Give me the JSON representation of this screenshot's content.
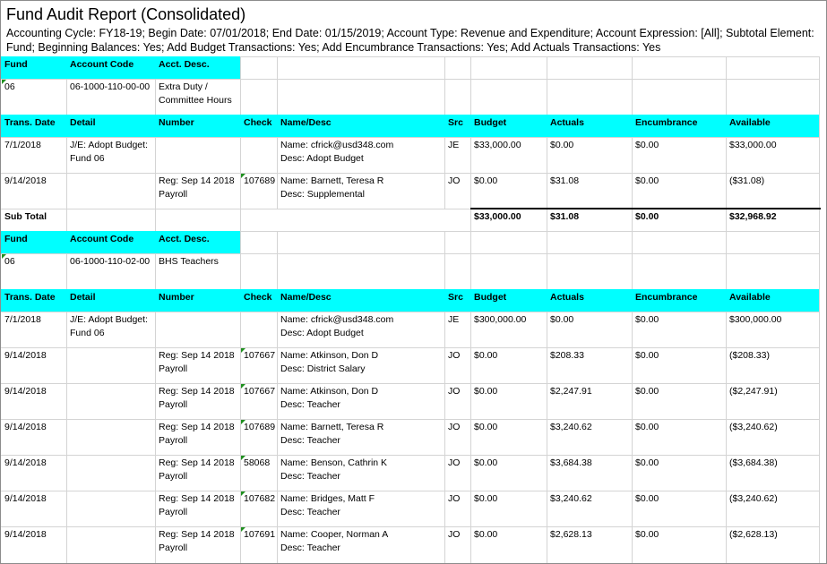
{
  "report": {
    "title": "Fund Audit Report (Consolidated)",
    "params": "Accounting Cycle: FY18-19; Begin Date: 07/01/2018; End Date: 01/15/2019; Account Type: Revenue and Expenditure; Account Expression: [All]; Subtotal Element: Fund; Beginning Balances: Yes; Add Budget Transactions: Yes; Add Encumbrance Transactions: Yes; Add Actuals Transactions: Yes"
  },
  "colors": {
    "header_band": "#00ffff",
    "grid": "#d4d4d4",
    "marker": "#1e8f1e"
  },
  "fund_headers": {
    "fund": "Fund",
    "account_code": "Account Code",
    "acct_desc": "Acct. Desc."
  },
  "trans_headers": {
    "date": "Trans. Date",
    "detail": "Detail",
    "number": "Number",
    "check": "Check",
    "name_desc": "Name/Desc",
    "src": "Src",
    "budget": "Budget",
    "actuals": "Actuals",
    "encumbrance": "Encumbrance",
    "available": "Available"
  },
  "sections": [
    {
      "fund": "06",
      "account_code": "06-1000-110-00-00",
      "acct_desc_1": "Extra Duty /",
      "acct_desc_2": "Committee Hours",
      "rows": [
        {
          "date": "7/1/2018",
          "detail_1": "J/E: Adopt Budget:",
          "detail_2": "Fund 06",
          "number_1": "",
          "number_2": "",
          "check": "",
          "name": "Name: cfrick@usd348.com",
          "desc": "Desc: Adopt Budget",
          "src": "JE",
          "budget": "$33,000.00",
          "actuals": "$0.00",
          "encumbrance": "$0.00",
          "available": "$33,000.00"
        },
        {
          "date": "9/14/2018",
          "detail_1": "",
          "detail_2": "",
          "number_1": "Reg: Sep 14 2018",
          "number_2": "Payroll",
          "check": "107689",
          "name": "Name: Barnett, Teresa R",
          "desc": "Desc: Supplemental",
          "src": "JO",
          "budget": "$0.00",
          "actuals": "$31.08",
          "encumbrance": "$0.00",
          "available": "($31.08)"
        }
      ],
      "subtotal": {
        "label": "Sub Total",
        "budget": "$33,000.00",
        "actuals": "$31.08",
        "encumbrance": "$0.00",
        "available": "$32,968.92"
      }
    },
    {
      "fund": "06",
      "account_code": "06-1000-110-02-00",
      "acct_desc_1": "BHS Teachers",
      "acct_desc_2": "",
      "rows": [
        {
          "date": "7/1/2018",
          "detail_1": "J/E: Adopt Budget:",
          "detail_2": "Fund 06",
          "number_1": "",
          "number_2": "",
          "check": "",
          "name": "Name: cfrick@usd348.com",
          "desc": "Desc: Adopt Budget",
          "src": "JE",
          "budget": "$300,000.00",
          "actuals": "$0.00",
          "encumbrance": "$0.00",
          "available": "$300,000.00"
        },
        {
          "date": "9/14/2018",
          "detail_1": "",
          "detail_2": "",
          "number_1": "Reg: Sep 14 2018",
          "number_2": "Payroll",
          "check": "107667",
          "name": "Name: Atkinson, Don D",
          "desc": "Desc: District Salary",
          "src": "JO",
          "budget": "$0.00",
          "actuals": "$208.33",
          "encumbrance": "$0.00",
          "available": "($208.33)"
        },
        {
          "date": "9/14/2018",
          "detail_1": "",
          "detail_2": "",
          "number_1": "Reg: Sep 14 2018",
          "number_2": "Payroll",
          "check": "107667",
          "name": "Name: Atkinson, Don D",
          "desc": "Desc: Teacher",
          "src": "JO",
          "budget": "$0.00",
          "actuals": "$2,247.91",
          "encumbrance": "$0.00",
          "available": "($2,247.91)"
        },
        {
          "date": "9/14/2018",
          "detail_1": "",
          "detail_2": "",
          "number_1": "Reg: Sep 14 2018",
          "number_2": "Payroll",
          "check": "107689",
          "name": "Name: Barnett, Teresa R",
          "desc": "Desc: Teacher",
          "src": "JO",
          "budget": "$0.00",
          "actuals": "$3,240.62",
          "encumbrance": "$0.00",
          "available": "($3,240.62)"
        },
        {
          "date": "9/14/2018",
          "detail_1": "",
          "detail_2": "",
          "number_1": "Reg: Sep 14 2018",
          "number_2": "Payroll",
          "check": "58068",
          "name": "Name: Benson, Cathrin K",
          "desc": "Desc: Teacher",
          "src": "JO",
          "budget": "$0.00",
          "actuals": "$3,684.38",
          "encumbrance": "$0.00",
          "available": "($3,684.38)"
        },
        {
          "date": "9/14/2018",
          "detail_1": "",
          "detail_2": "",
          "number_1": "Reg: Sep 14 2018",
          "number_2": "Payroll",
          "check": "107682",
          "name": "Name: Bridges, Matt F",
          "desc": "Desc: Teacher",
          "src": "JO",
          "budget": "$0.00",
          "actuals": "$3,240.62",
          "encumbrance": "$0.00",
          "available": "($3,240.62)"
        },
        {
          "date": "9/14/2018",
          "detail_1": "",
          "detail_2": "",
          "number_1": "Reg: Sep 14 2018",
          "number_2": "Payroll",
          "check": "107691",
          "name": "Name: Cooper, Norman A",
          "desc": "Desc: Teacher",
          "src": "JO",
          "budget": "$0.00",
          "actuals": "$2,628.13",
          "encumbrance": "$0.00",
          "available": "($2,628.13)"
        }
      ]
    }
  ]
}
